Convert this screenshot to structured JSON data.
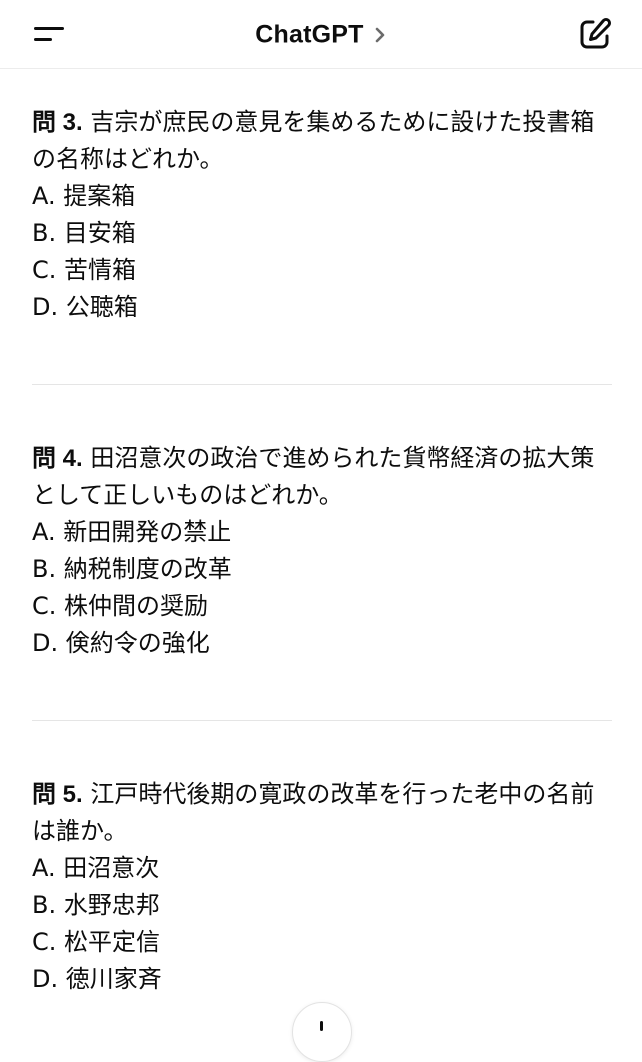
{
  "header": {
    "title": "ChatGPT",
    "menu_icon": "menu-icon",
    "chevron_icon": "chevron-right-icon",
    "compose_icon": "compose-icon"
  },
  "questions": [
    {
      "number": "問 3.",
      "text": "吉宗が庶民の意見を集めるために設けた投書箱の名称はどれか。",
      "options": [
        "A. 提案箱",
        "B. 目安箱",
        "C. 苦情箱",
        "D. 公聴箱"
      ]
    },
    {
      "number": "問 4.",
      "text": "田沼意次の政治で進められた貨幣経済の拡大策として正しいものはどれか。",
      "options": [
        "A. 新田開発の禁止",
        "B. 納税制度の改革",
        "C. 株仲間の奨励",
        "D. 倹約令の強化"
      ]
    },
    {
      "number": "問 5.",
      "text": "江戸時代後期の寛政の改革を行った老中の名前は誰か。",
      "options": [
        "A. 田沼意次",
        "B. 水野忠邦",
        "C. 松平定信",
        "D. 徳川家斉"
      ]
    }
  ],
  "scroll_button": {
    "icon": "arrow-down-icon"
  }
}
